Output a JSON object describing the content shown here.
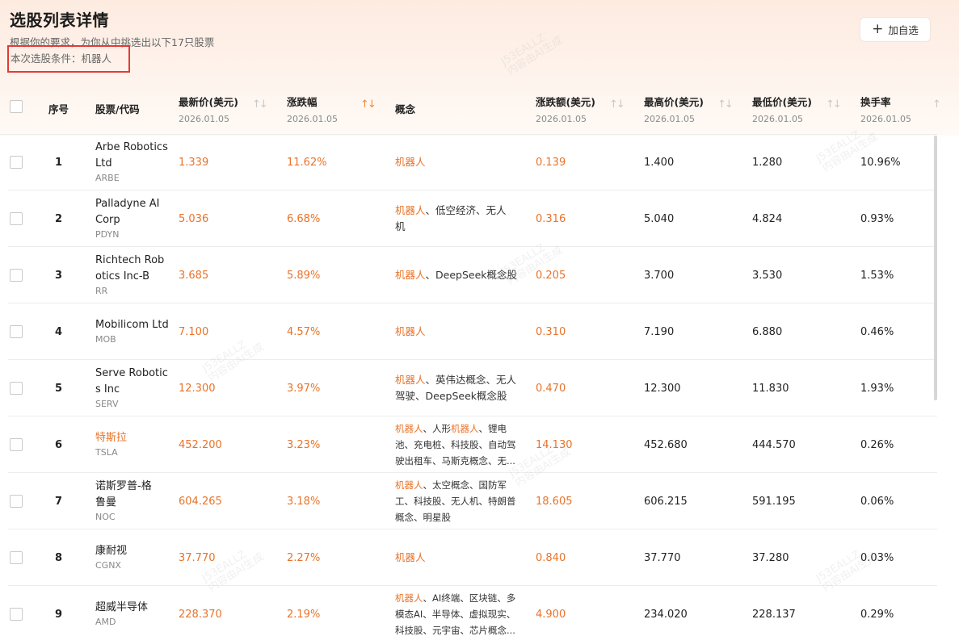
{
  "header": {
    "title": "选股列表详情",
    "subtitle": "根据你的要求，为你从中挑选出以下17只股票",
    "condition": "本次选股条件：机器人",
    "add_button": "加自选"
  },
  "columns": [
    {
      "key": "index",
      "label": "序号",
      "sub": ""
    },
    {
      "key": "stock",
      "label": "股票/代码",
      "sub": ""
    },
    {
      "key": "price",
      "label": "最新价(美元)",
      "sub": "2026.01.05"
    },
    {
      "key": "change_pct",
      "label": "涨跌幅",
      "sub": "2026.01.05"
    },
    {
      "key": "concept",
      "label": "概念",
      "sub": ""
    },
    {
      "key": "change_amt",
      "label": "涨跌额(美元)",
      "sub": "2026.01.05"
    },
    {
      "key": "high",
      "label": "最高价(美元)",
      "sub": "2026.01.05"
    },
    {
      "key": "low",
      "label": "最低价(美元)",
      "sub": "2026.01.05"
    },
    {
      "key": "turnover",
      "label": "换手率",
      "sub": "2026.01.05"
    }
  ],
  "watermark": [
    "J53EALLZ",
    "内容由AI生成"
  ],
  "rows": [
    {
      "index": "1",
      "name": [
        "Arbe Robotics",
        "Ltd"
      ],
      "code": "ARBE",
      "price": "1.339",
      "change_pct": "11.62%",
      "concept": [
        [
          "机器人"
        ]
      ],
      "change_amt": "0.139",
      "high": "1.400",
      "low": "1.280",
      "turnover": "10.96%"
    },
    {
      "index": "2",
      "name": [
        "Palladyne AI",
        "Corp"
      ],
      "code": "PDYN",
      "price": "5.036",
      "change_pct": "6.68%",
      "concept": [
        [
          "机器人",
          "、低空经济、无人"
        ],
        [
          "",
          "机"
        ]
      ],
      "change_amt": "0.316",
      "high": "5.040",
      "low": "4.824",
      "turnover": "0.93%"
    },
    {
      "index": "3",
      "name": [
        "Richtech Rob",
        "otics Inc-B"
      ],
      "code": "RR",
      "price": "3.685",
      "change_pct": "5.89%",
      "concept": [
        [
          "机器人",
          "、DeepSeek概念股"
        ]
      ],
      "change_amt": "0.205",
      "high": "3.700",
      "low": "3.530",
      "turnover": "1.53%"
    },
    {
      "index": "4",
      "name": [
        "Mobilicom Ltd"
      ],
      "code": "MOB",
      "price": "7.100",
      "change_pct": "4.57%",
      "concept": [
        [
          "机器人"
        ]
      ],
      "change_amt": "0.310",
      "high": "7.190",
      "low": "6.880",
      "turnover": "0.46%"
    },
    {
      "index": "5",
      "name": [
        "Serve Robotic",
        "s Inc"
      ],
      "code": "SERV",
      "price": "12.300",
      "change_pct": "3.97%",
      "concept": [
        [
          "机器人",
          "、英伟达概念、无人"
        ],
        [
          "",
          "驾驶、DeepSeek概念股"
        ]
      ],
      "change_amt": "0.470",
      "high": "12.300",
      "low": "11.830",
      "turnover": "1.93%"
    },
    {
      "index": "6",
      "name": [
        "特斯拉"
      ],
      "name_link": true,
      "code": "TSLA",
      "price": "452.200",
      "change_pct": "3.23%",
      "concept_small": true,
      "concept": [
        [
          "机器人",
          "、人形",
          "机器人",
          "、锂电"
        ],
        [
          "",
          "池、充电桩、科技股、自动驾"
        ],
        [
          "",
          "驶出租车、马斯克概念、无..."
        ]
      ],
      "change_amt": "14.130",
      "high": "452.680",
      "low": "444.570",
      "turnover": "0.26%"
    },
    {
      "index": "7",
      "name": [
        "诺斯罗普-格",
        "鲁曼"
      ],
      "code": "NOC",
      "price": "604.265",
      "change_pct": "3.18%",
      "concept_small": true,
      "concept": [
        [
          "机器人",
          "、太空概念、国防军"
        ],
        [
          "",
          "工、科技股、无人机、特朗普"
        ],
        [
          "",
          "概念、明星股"
        ]
      ],
      "change_amt": "18.605",
      "high": "606.215",
      "low": "591.195",
      "turnover": "0.06%"
    },
    {
      "index": "8",
      "name": [
        "康耐视"
      ],
      "code": "CGNX",
      "price": "37.770",
      "change_pct": "2.27%",
      "concept": [
        [
          "机器人"
        ]
      ],
      "change_amt": "0.840",
      "high": "37.770",
      "low": "37.280",
      "turnover": "0.03%"
    },
    {
      "index": "9",
      "name": [
        "超威半导体"
      ],
      "code": "AMD",
      "price": "228.370",
      "change_pct": "2.19%",
      "concept_small": true,
      "concept": [
        [
          "机器人",
          "、AI终端、区块链、多"
        ],
        [
          "",
          "模态AI、半导体、虚拟现实、"
        ],
        [
          "",
          "科技股、元宇宙、芯片概念..."
        ]
      ],
      "change_amt": "4.900",
      "high": "234.020",
      "low": "228.137",
      "turnover": "0.29%"
    }
  ]
}
